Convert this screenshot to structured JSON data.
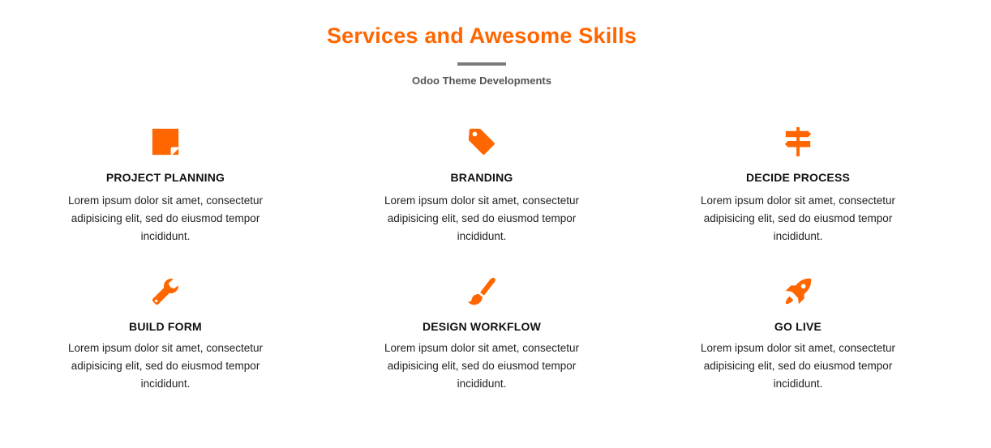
{
  "header": {
    "title": "Services and Awesome Skills",
    "subtitle": "Odoo Theme Developments"
  },
  "accent_color": "#ff6600",
  "services": [
    {
      "icon": "sticky-note-icon",
      "title": "PROJECT PLANNING",
      "description": "Lorem ipsum dolor sit amet, consectetur adipisicing elit, sed do eiusmod tempor incididunt."
    },
    {
      "icon": "tag-icon",
      "title": "BRANDING",
      "description": "Lorem ipsum dolor sit amet, consectetur adipisicing elit, sed do eiusmod tempor incididunt."
    },
    {
      "icon": "signpost-icon",
      "title": "DECIDE PROCESS",
      "description": "Lorem ipsum dolor sit amet, consectetur adipisicing elit, sed do eiusmod tempor incididunt."
    },
    {
      "icon": "wrench-icon",
      "title": "BUILD FORM",
      "description": "Lorem ipsum dolor sit amet, consectetur adipisicing elit, sed do eiusmod tempor incididunt."
    },
    {
      "icon": "paintbrush-icon",
      "title": "DESIGN WORKFLOW",
      "description": "Lorem ipsum dolor sit amet, consectetur adipisicing elit, sed do eiusmod tempor incididunt."
    },
    {
      "icon": "rocket-icon",
      "title": "GO LIVE",
      "description": "Lorem ipsum dolor sit amet, consectetur adipisicing elit, sed do eiusmod tempor incididunt."
    }
  ]
}
